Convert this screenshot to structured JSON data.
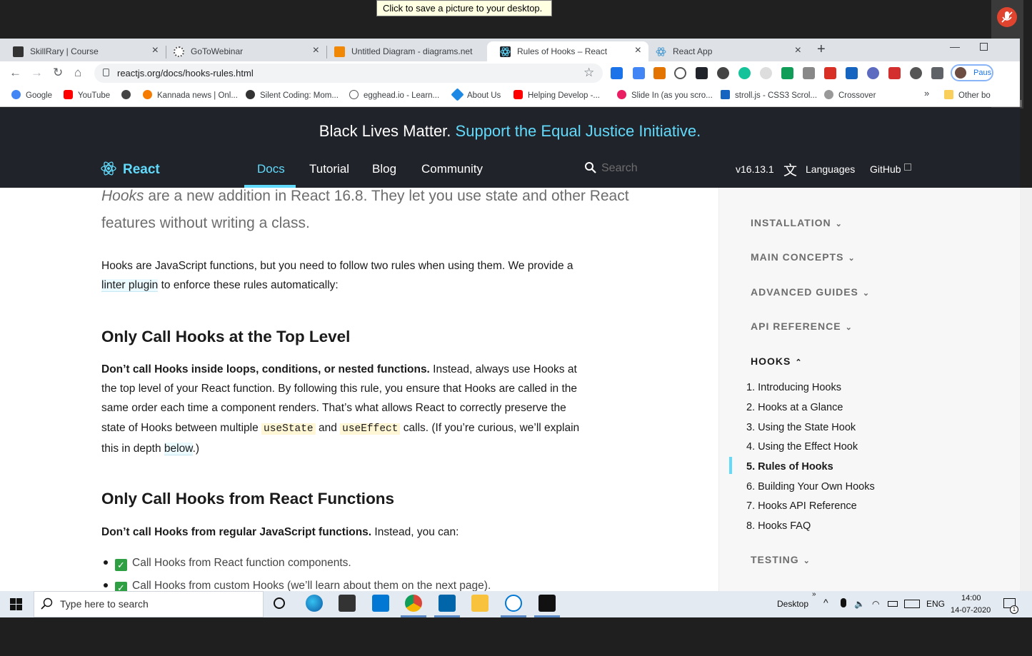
{
  "tooltip": "Click to save a picture to your desktop.",
  "tabs": [
    {
      "title": "SkillRary | Course",
      "color": "#333333"
    },
    {
      "title": "GoToWebinar",
      "color": "#555555"
    },
    {
      "title": "Untitled Diagram - diagrams.net",
      "color": "#f08705"
    },
    {
      "title": "Rules of Hooks – React",
      "color": "#20232a"
    },
    {
      "title": "React App",
      "color": "#61dafb"
    }
  ],
  "new_tab": "+",
  "close_glyph": "×",
  "url": "reactjs.org/docs/hooks-rules.html",
  "pause_label": "Paus",
  "bookmarks": [
    "Google",
    "YouTube",
    "",
    "Kannada news | Onl...",
    "Silent Coding: Mom...",
    "egghead.io - Learn...",
    "About Us",
    "Helping Develop -...",
    "Slide In (as you scro...",
    "stroll.js - CSS3 Scrol...",
    "Crossover"
  ],
  "bookmarks_more": "»",
  "other_bookmarks": "Other bo",
  "banner": {
    "text": "Black Lives Matter.",
    "link": "Support the Equal Justice Initiative."
  },
  "nav": {
    "logo": "React",
    "links": [
      "Docs",
      "Tutorial",
      "Blog",
      "Community"
    ],
    "search_placeholder": "Search",
    "version": "v16.13.1",
    "languages": "Languages",
    "github": "GitHub"
  },
  "content": {
    "intro_em": "Hooks",
    "intro_line1": " are a new addition in React 16.8. They let you use state and other React",
    "intro_line2": "features without writing a class.",
    "p1_a": "Hooks are JavaScript functions, but you need to follow two rules when using them. We provide a ",
    "p1_link": "linter plugin",
    "p1_b": " to enforce these rules automatically:",
    "h2_1": "Only Call Hooks at the Top Level",
    "p2_bold": "Don’t call Hooks inside loops, conditions, or nested functions.",
    "p2_a": " Instead, always use Hooks at the top level of your React function. By following this rule, you ensure that Hooks are called in the same order each time a component renders. That’s what allows React to correctly preserve the state of Hooks between multiple ",
    "p2_code1": "useState",
    "p2_and": " and ",
    "p2_code2": "useEffect",
    "p2_b": " calls. (If you’re curious, we’ll explain this in depth ",
    "p2_link": "below",
    "p2_c": ".)",
    "h2_2": "Only Call Hooks from React Functions",
    "p3_bold": "Don’t call Hooks from regular JavaScript functions.",
    "p3_a": " Instead, you can:",
    "check_glyph": "✓",
    "li1": "Call Hooks from React function components.",
    "li2": "Call Hooks from custom Hooks (we’ll learn about them on the next page)."
  },
  "sidebar": {
    "sections": [
      "INSTALLATION",
      "MAIN CONCEPTS",
      "ADVANCED GUIDES",
      "API REFERENCE",
      "HOOKS",
      "TESTING"
    ],
    "chev_down": "⌄",
    "chev_up": "⌃",
    "hooks_items": [
      "1. Introducing Hooks",
      "2. Hooks at a Glance",
      "3. Using the State Hook",
      "4. Using the Effect Hook",
      "5. Rules of Hooks",
      "6. Building Your Own Hooks",
      "7. Hooks API Reference",
      "8. Hooks FAQ"
    ],
    "active_index": 4
  },
  "taskbar": {
    "search_placeholder": "Type here to search",
    "desktop": "Desktop",
    "desktop_chevron": "»",
    "lang": "ENG",
    "time": "14:00",
    "date": "14-07-2020",
    "notification_count": "1"
  },
  "colors": {
    "react_dark": "#20232a",
    "react_cyan": "#61dafb"
  }
}
